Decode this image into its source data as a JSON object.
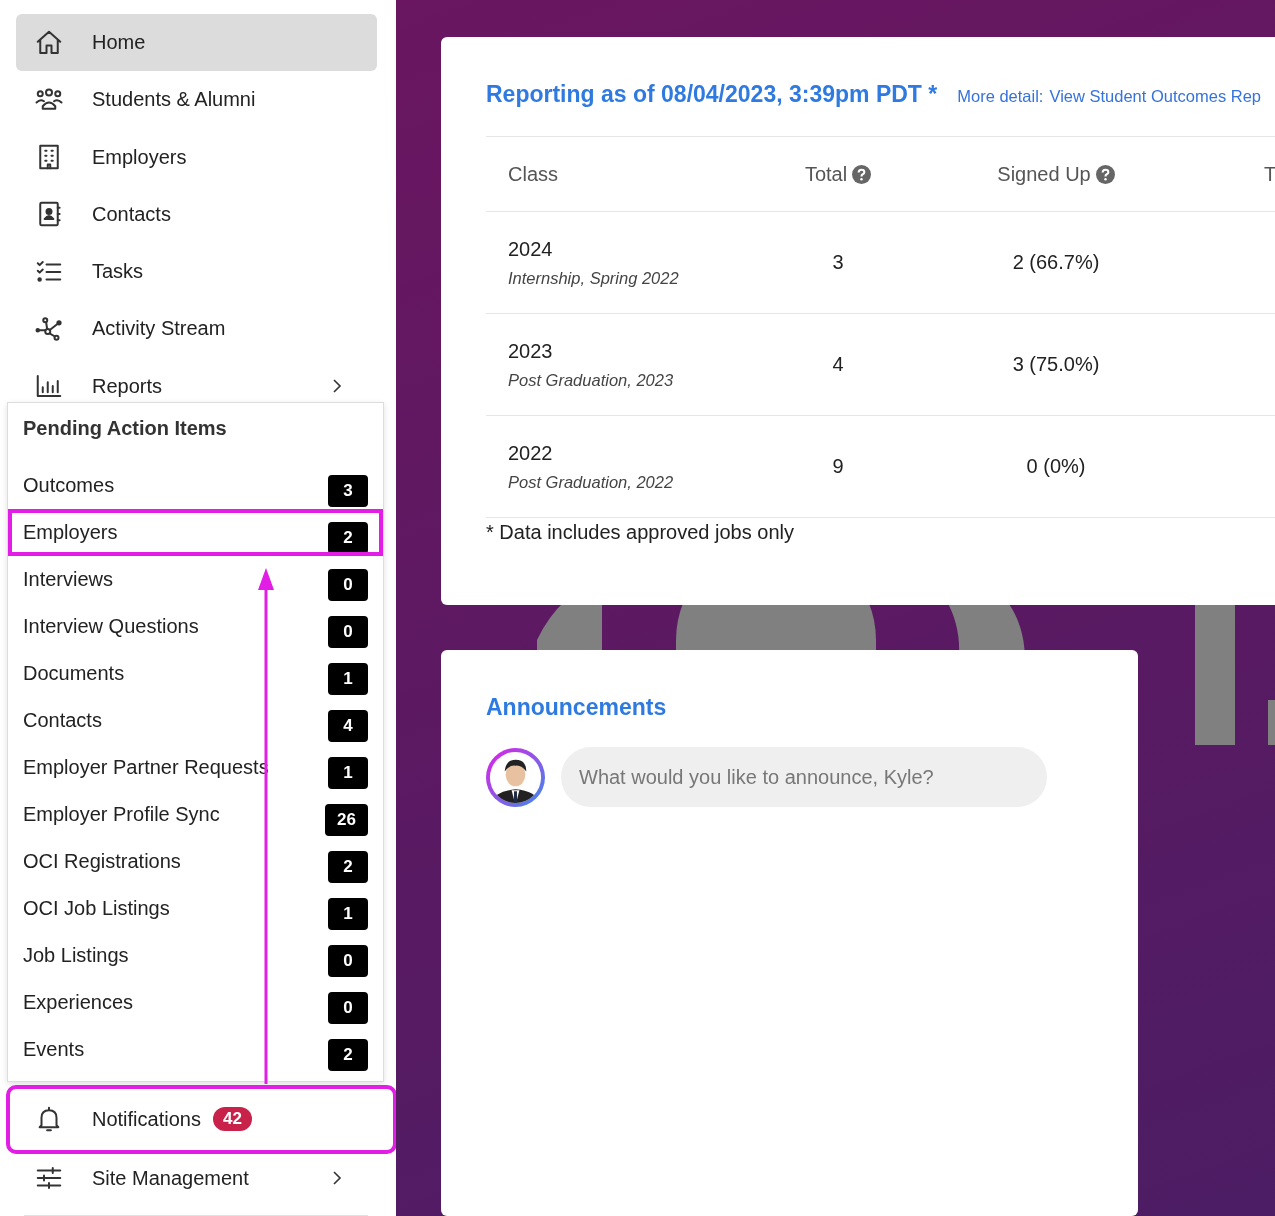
{
  "sidebar": {
    "nav_top": [
      {
        "label": "Home",
        "selected": true,
        "expandable": false,
        "highlighted": false
      },
      {
        "label": "Students & Alumni",
        "selected": false,
        "expandable": false,
        "highlighted": false
      },
      {
        "label": "Employers",
        "selected": false,
        "expandable": false,
        "highlighted": false
      },
      {
        "label": "Contacts",
        "selected": false,
        "expandable": false,
        "highlighted": false
      },
      {
        "label": "Tasks",
        "selected": false,
        "expandable": false,
        "highlighted": false
      },
      {
        "label": "Activity Stream",
        "selected": false,
        "expandable": false,
        "highlighted": false
      },
      {
        "label": "Reports",
        "selected": false,
        "expandable": true,
        "highlighted": false
      }
    ],
    "pending_action_items": {
      "title": "Pending Action Items",
      "items": [
        {
          "label": "Outcomes",
          "count": "3",
          "highlighted": false
        },
        {
          "label": "Employers",
          "count": "2",
          "highlighted": true
        },
        {
          "label": "Interviews",
          "count": "0",
          "highlighted": false
        },
        {
          "label": "Interview Questions",
          "count": "0",
          "highlighted": false
        },
        {
          "label": "Documents",
          "count": "1",
          "highlighted": false
        },
        {
          "label": "Contacts",
          "count": "4",
          "highlighted": false
        },
        {
          "label": "Employer Partner Requests",
          "count": "1",
          "highlighted": false
        },
        {
          "label": "Employer Profile Sync",
          "count": "26",
          "highlighted": false
        },
        {
          "label": "OCI Registrations",
          "count": "2",
          "highlighted": false
        },
        {
          "label": "OCI Job Listings",
          "count": "1",
          "highlighted": false
        },
        {
          "label": "Job Listings",
          "count": "0",
          "highlighted": false
        },
        {
          "label": "Experiences",
          "count": "0",
          "highlighted": false
        },
        {
          "label": "Events",
          "count": "2",
          "highlighted": false
        }
      ]
    },
    "nav_bottom": [
      {
        "label": "Notifications",
        "badge": "42",
        "selected": false,
        "expandable": false,
        "highlighted": true
      },
      {
        "label": "Site Management",
        "selected": false,
        "expandable": true,
        "highlighted": false
      }
    ]
  },
  "outcomes_card": {
    "title": "Reporting as of 08/04/2023, 3:39pm PDT *",
    "more_detail_label": "More detail:",
    "more_detail_link": "View Student Outcomes Rep",
    "columns": [
      {
        "label": "Class",
        "help": false
      },
      {
        "label": "Total",
        "help": true
      },
      {
        "label": "Signed Up",
        "help": true
      },
      {
        "label": "T"
      }
    ],
    "rows": [
      {
        "class": "2024",
        "term": "Internship, Spring 2022",
        "total": "3",
        "signed_up": "2 (66.7%)"
      },
      {
        "class": "2023",
        "term": "Post Graduation, 2023",
        "total": "4",
        "signed_up": "3 (75.0%)"
      },
      {
        "class": "2022",
        "term": "Post Graduation, 2022",
        "total": "9",
        "signed_up": "0 (0%)"
      }
    ],
    "footnote": "* Data includes approved jobs only"
  },
  "announcements": {
    "title": "Announcements",
    "placeholder": "What would you like to announce, Kyle?"
  }
}
